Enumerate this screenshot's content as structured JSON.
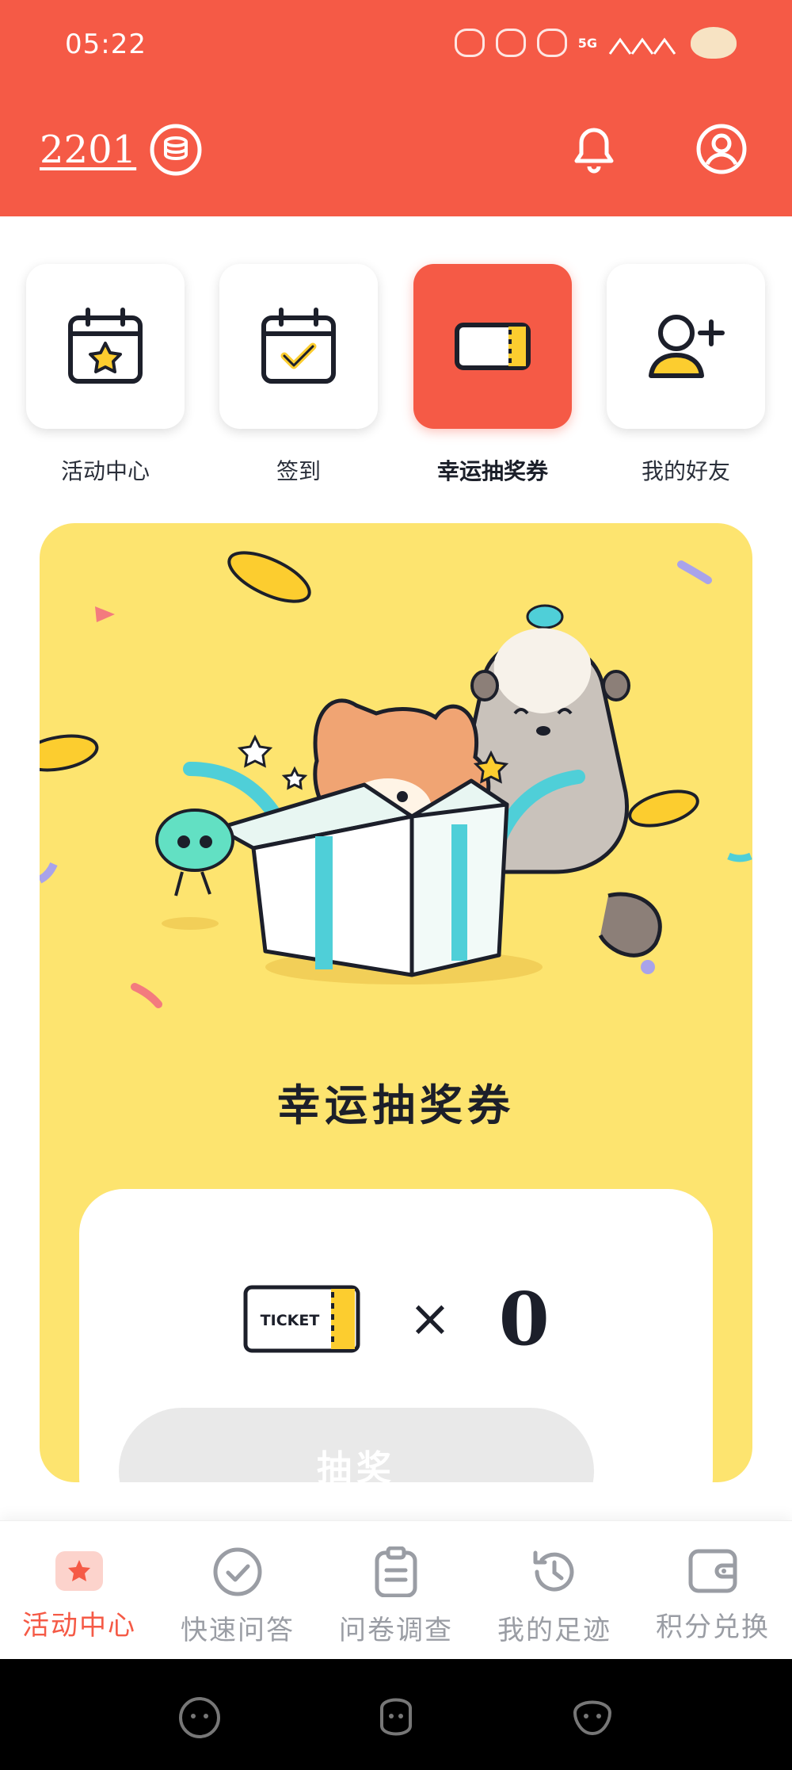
{
  "status_bar": {
    "time": "05:22",
    "network": "5G"
  },
  "header": {
    "points": "2201",
    "icons": [
      "coin-stack-icon",
      "bell-icon",
      "user-icon"
    ],
    "bg_color": "#f55a46"
  },
  "quick_menu": [
    {
      "label": "活动中心",
      "icon": "calendar-star-icon",
      "active": false
    },
    {
      "label": "签到",
      "icon": "calendar-check-icon",
      "active": false
    },
    {
      "label": "幸运抽奖券",
      "icon": "ticket-icon",
      "active": true
    },
    {
      "label": "我的好友",
      "icon": "add-friend-icon",
      "active": false
    }
  ],
  "lucky": {
    "title": "幸运抽奖券",
    "ticket_badge": "TICKET",
    "multiply_sign": "×",
    "ticket_count": "0",
    "draw_button": "抽奖",
    "panel_color": "#fde46f"
  },
  "bottom_nav": [
    {
      "label": "活动中心",
      "icon": "activity-star-icon",
      "active": true
    },
    {
      "label": "快速问答",
      "icon": "check-circle-icon",
      "active": false
    },
    {
      "label": "问卷调查",
      "icon": "clipboard-icon",
      "active": false
    },
    {
      "label": "我的足迹",
      "icon": "history-icon",
      "active": false
    },
    {
      "label": "积分兑换",
      "icon": "wallet-icon",
      "active": false
    }
  ],
  "accent_color": "#f55a46"
}
